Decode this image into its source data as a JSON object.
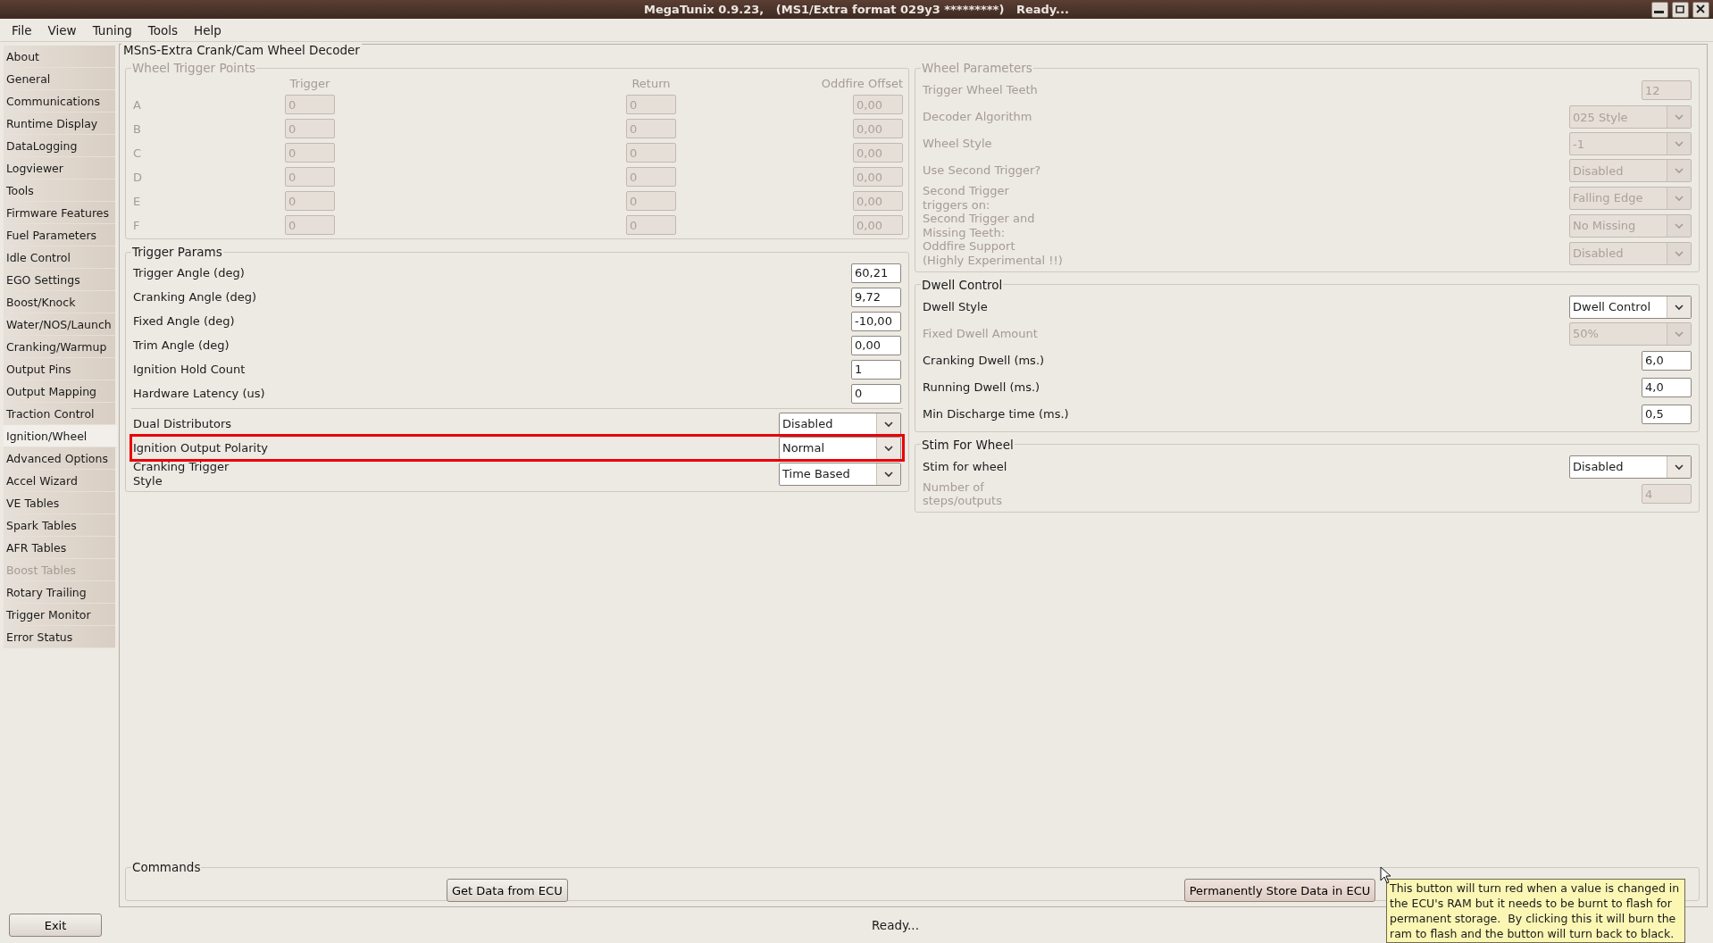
{
  "window": {
    "title": "MegaTunix 0.9.23,   (MS1/Extra format 029y3 *********)   Ready..."
  },
  "menu": [
    "File",
    "View",
    "Tuning",
    "Tools",
    "Help"
  ],
  "sidebar": {
    "items": [
      {
        "label": "About",
        "selected": false,
        "disabled": false
      },
      {
        "label": "General",
        "selected": false,
        "disabled": false
      },
      {
        "label": "Communications",
        "selected": false,
        "disabled": false
      },
      {
        "label": "Runtime Display",
        "selected": false,
        "disabled": false
      },
      {
        "label": "DataLogging",
        "selected": false,
        "disabled": false
      },
      {
        "label": "Logviewer",
        "selected": false,
        "disabled": false
      },
      {
        "label": "Tools",
        "selected": false,
        "disabled": false
      },
      {
        "label": "Firmware Features",
        "selected": false,
        "disabled": false
      },
      {
        "label": "Fuel Parameters",
        "selected": false,
        "disabled": false
      },
      {
        "label": "Idle Control",
        "selected": false,
        "disabled": false
      },
      {
        "label": "EGO Settings",
        "selected": false,
        "disabled": false
      },
      {
        "label": "Boost/Knock",
        "selected": false,
        "disabled": false
      },
      {
        "label": "Water/NOS/Launch",
        "selected": false,
        "disabled": false
      },
      {
        "label": "Cranking/Warmup",
        "selected": false,
        "disabled": false
      },
      {
        "label": "Output Pins",
        "selected": false,
        "disabled": false
      },
      {
        "label": "Output Mapping",
        "selected": false,
        "disabled": false
      },
      {
        "label": "Traction Control",
        "selected": false,
        "disabled": false
      },
      {
        "label": "Ignition/Wheel",
        "selected": true,
        "disabled": false
      },
      {
        "label": "Advanced Options",
        "selected": false,
        "disabled": false
      },
      {
        "label": "Accel Wizard",
        "selected": false,
        "disabled": false
      },
      {
        "label": "VE Tables",
        "selected": false,
        "disabled": false
      },
      {
        "label": "Spark Tables",
        "selected": false,
        "disabled": false
      },
      {
        "label": "AFR Tables",
        "selected": false,
        "disabled": false
      },
      {
        "label": "Boost Tables",
        "selected": false,
        "disabled": true
      },
      {
        "label": "Rotary Trailing",
        "selected": false,
        "disabled": false
      },
      {
        "label": "Trigger Monitor",
        "selected": false,
        "disabled": false
      },
      {
        "label": "Error Status",
        "selected": false,
        "disabled": false
      }
    ],
    "exit_button": "Exit"
  },
  "panel": {
    "title": "MSnS-Extra Crank/Cam Wheel Decoder",
    "wheel_trigger_points": {
      "title": "Wheel Trigger Points",
      "disabled": true,
      "columns": [
        "Trigger",
        "Return",
        "Oddfire Offset"
      ],
      "rows": [
        {
          "label": "A",
          "values": [
            "0",
            "0",
            "0,00"
          ]
        },
        {
          "label": "B",
          "values": [
            "0",
            "0",
            "0,00"
          ]
        },
        {
          "label": "C",
          "values": [
            "0",
            "0",
            "0,00"
          ]
        },
        {
          "label": "D",
          "values": [
            "0",
            "0",
            "0,00"
          ]
        },
        {
          "label": "E",
          "values": [
            "0",
            "0",
            "0,00"
          ]
        },
        {
          "label": "F",
          "values": [
            "0",
            "0",
            "0,00"
          ]
        }
      ]
    },
    "trigger_params": {
      "title": "Trigger Params",
      "fields": [
        {
          "kind": "entry",
          "label": "Trigger Angle (deg)",
          "value": "60,21",
          "disabled": false,
          "highlighted": false
        },
        {
          "kind": "entry",
          "label": "Cranking Angle (deg)",
          "value": "9,72",
          "disabled": false,
          "highlighted": false
        },
        {
          "kind": "entry",
          "label": "Fixed Angle (deg)",
          "value": "-10,00",
          "disabled": false,
          "highlighted": false
        },
        {
          "kind": "entry",
          "label": "Trim Angle (deg)",
          "value": "0,00",
          "disabled": false,
          "highlighted": false
        },
        {
          "kind": "entry",
          "label": "Ignition Hold Count",
          "value": "1",
          "disabled": false,
          "highlighted": false
        },
        {
          "kind": "entry",
          "label": "Hardware Latency (us)",
          "value": "0",
          "disabled": false,
          "highlighted": false
        }
      ],
      "selectors": [
        {
          "kind": "combo",
          "label": "Dual Distributors",
          "value": "Disabled",
          "disabled": false,
          "highlighted": false
        },
        {
          "kind": "combo",
          "label": "Ignition Output Polarity",
          "value": "Normal",
          "disabled": false,
          "highlighted": true
        },
        {
          "kind": "combo",
          "label": "Cranking Trigger\nStyle",
          "value": "Time Based",
          "disabled": false,
          "highlighted": false
        }
      ]
    },
    "wheel_parameters": {
      "title": "Wheel Parameters",
      "disabled": true,
      "fields": [
        {
          "kind": "entry",
          "label": "Trigger Wheel Teeth",
          "value": "12",
          "disabled": true
        },
        {
          "kind": "combo",
          "label": "Decoder Algorithm",
          "value": "025 Style",
          "disabled": true
        },
        {
          "kind": "combo",
          "label": "Wheel Style",
          "value": "-1",
          "disabled": true
        },
        {
          "kind": "combo",
          "label": "Use Second Trigger?",
          "value": "Disabled",
          "disabled": true
        },
        {
          "kind": "combo",
          "label": "Second Trigger\ntriggers on:",
          "value": "Falling Edge",
          "disabled": true
        },
        {
          "kind": "combo",
          "label": "Second Trigger and\nMissing Teeth:",
          "value": "No Missing",
          "disabled": true
        },
        {
          "kind": "combo",
          "label": "Oddfire Support\n(Highly Experimental !!)",
          "value": "Disabled",
          "disabled": true
        }
      ]
    },
    "dwell_control": {
      "title": "Dwell Control",
      "disabled": false,
      "fields": [
        {
          "kind": "combo",
          "label": "Dwell Style",
          "value": "Dwell Control",
          "disabled": false
        },
        {
          "kind": "combo",
          "label": "Fixed Dwell Amount",
          "value": "50%",
          "disabled": true
        },
        {
          "kind": "entry",
          "label": "Cranking Dwell (ms.)",
          "value": "6,0",
          "disabled": false
        },
        {
          "kind": "entry",
          "label": "Running Dwell (ms.)",
          "value": "4,0",
          "disabled": false
        },
        {
          "kind": "entry",
          "label": "Min Discharge time (ms.)",
          "value": "0,5",
          "disabled": false
        }
      ]
    },
    "stim_for_wheel": {
      "title": "Stim For Wheel",
      "disabled": false,
      "fields": [
        {
          "kind": "combo",
          "label": "Stim for wheel",
          "value": "Disabled",
          "disabled": false
        },
        {
          "kind": "entry",
          "label": "Number of\nsteps/outputs",
          "value": "4",
          "disabled": true
        }
      ]
    },
    "commands": {
      "title": "Commands",
      "buttons": [
        "Get Data from ECU",
        "Permanently Store Data in ECU"
      ]
    }
  },
  "status_bar": "Ready...",
  "tooltip": "This button will turn red when a value is changed in\nthe ECU's RAM but it needs to be burnt to flash for\npermanent storage.  By clicking this it will burn the\nram to flash and the button will turn back to black."
}
